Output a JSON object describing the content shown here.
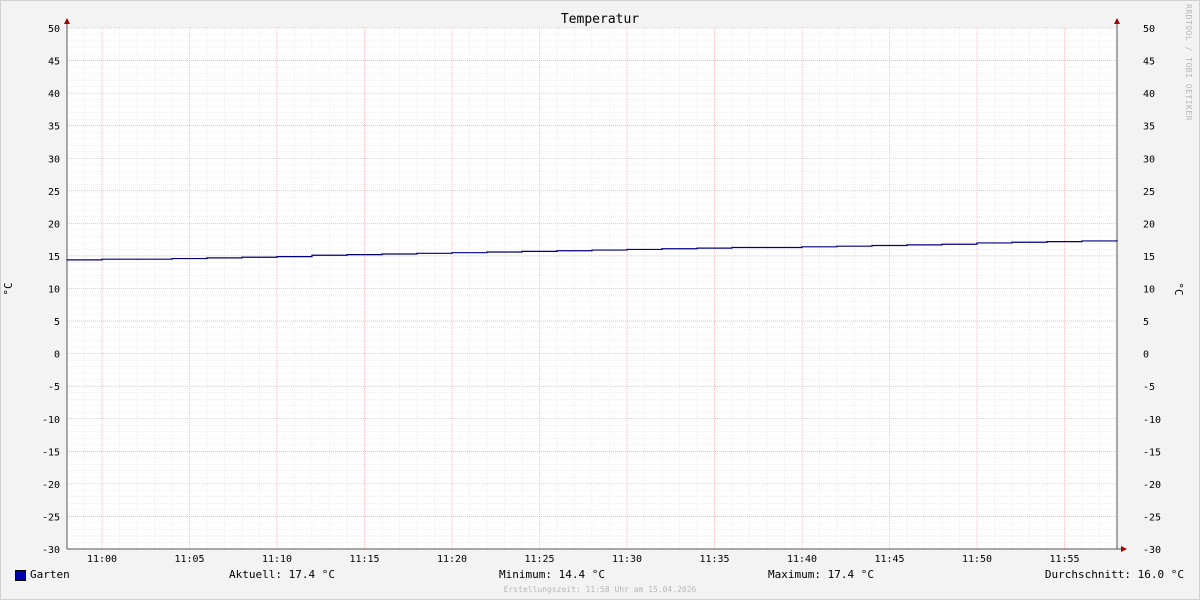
{
  "chart_data": {
    "type": "line",
    "title": "Temperatur",
    "ylabel_left": "°C",
    "ylabel_right": "°C",
    "ylim": [
      -30,
      50
    ],
    "y_ticks": [
      50,
      45,
      40,
      35,
      30,
      25,
      20,
      15,
      10,
      5,
      0,
      -5,
      -10,
      -15,
      -20,
      -25,
      -30
    ],
    "x_tick_labels": [
      "11:00",
      "11:05",
      "11:10",
      "11:15",
      "11:20",
      "11:25",
      "11:30",
      "11:35",
      "11:40",
      "11:45",
      "11:50",
      "11:55"
    ],
    "x_range": [
      "10:58",
      "11:58"
    ],
    "grid": true,
    "series": [
      {
        "name": "Garten",
        "color": "#000080",
        "x": [
          "10:58",
          "11:00",
          "11:02",
          "11:04",
          "11:06",
          "11:08",
          "11:10",
          "11:12",
          "11:14",
          "11:16",
          "11:18",
          "11:20",
          "11:22",
          "11:24",
          "11:26",
          "11:28",
          "11:30",
          "11:32",
          "11:34",
          "11:36",
          "11:38",
          "11:40",
          "11:42",
          "11:44",
          "11:46",
          "11:48",
          "11:50",
          "11:52",
          "11:54",
          "11:56",
          "11:58"
        ],
        "values": [
          14.4,
          14.5,
          14.5,
          14.6,
          14.7,
          14.8,
          14.9,
          15.1,
          15.2,
          15.3,
          15.4,
          15.5,
          15.6,
          15.7,
          15.8,
          15.9,
          16.0,
          16.1,
          16.2,
          16.3,
          16.3,
          16.4,
          16.5,
          16.6,
          16.7,
          16.8,
          17.0,
          17.1,
          17.2,
          17.3,
          17.4
        ]
      }
    ]
  },
  "legend": {
    "series_name": "Garten",
    "aktuell": "Aktuell: 17.4 °C",
    "minimum": "Minimum: 14.4 °C",
    "maximum": "Maximum: 17.4 °C",
    "durchschnitt": "Durchschnitt: 16.0 °C"
  },
  "footer": "Erstellungszeit: 11:58 Uhr am 15.04.2026",
  "watermark": "RRDTOOL / TOBI OETIKER"
}
